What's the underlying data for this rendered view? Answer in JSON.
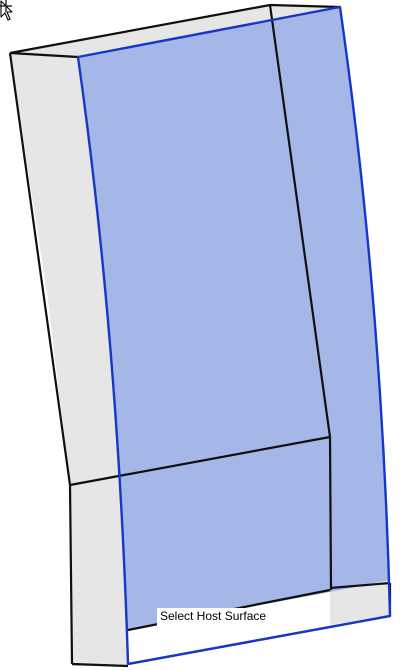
{
  "viewport": {
    "tooltip_text": "Select Host Surface",
    "cursor_icon": "arrow-pointer-icon",
    "crosshair_icon": "crosshair-icon"
  },
  "colors": {
    "background": "#ffffff",
    "side_face": "#e6e6e6",
    "highlight_face": "#a5b7e6",
    "highlight_edge": "#1637c8",
    "model_edge": "#101010",
    "tooltip_bg": "#ffffff"
  }
}
